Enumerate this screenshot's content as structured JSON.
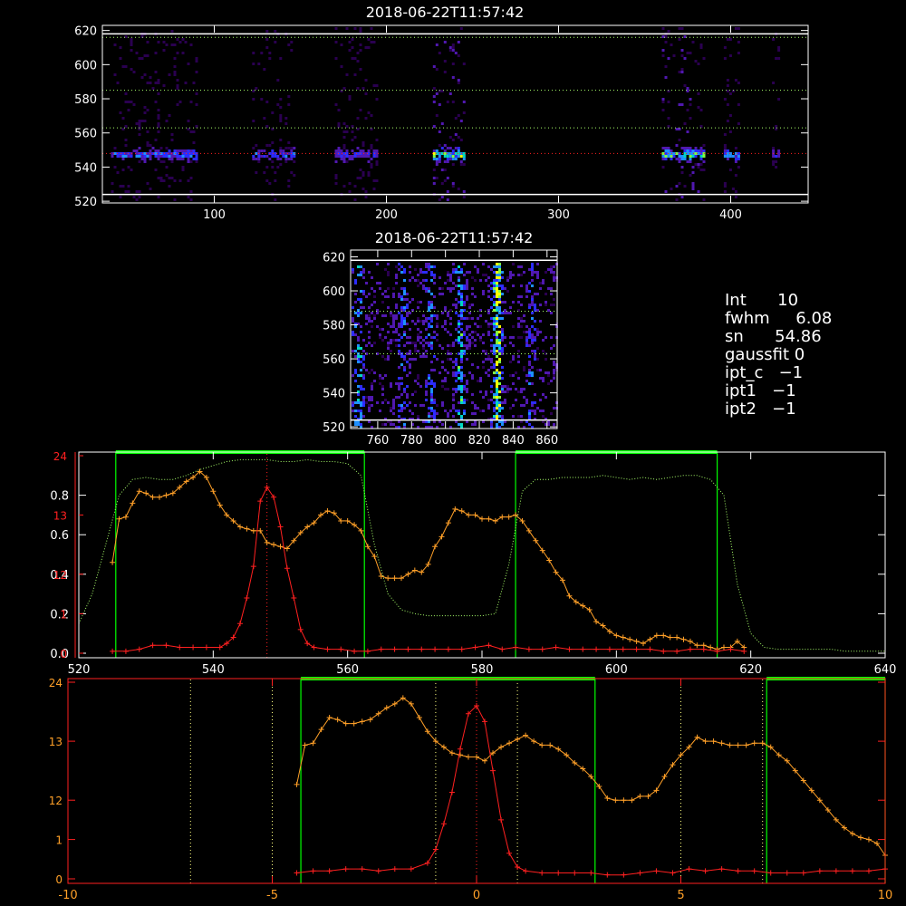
{
  "colors": {
    "background": "#000000",
    "axes": "#ffffff",
    "orange": "#ffa028",
    "red": "#ff2020",
    "green": "#00ff00",
    "green_dotted": "#a8ff6a",
    "yellow_dotted": "#ffff80"
  },
  "info": {
    "int_label": "Int",
    "int_value": "10",
    "fwhm_label": "fwhm",
    "fwhm_value": "6.08",
    "sn_label": "sn",
    "sn_value": "54.86",
    "gaussfit_label": "gaussfit",
    "gaussfit_value": "0",
    "ipt_c_label": "ipt_c",
    "ipt_c_value": "−1",
    "ipt1_label": "ipt1",
    "ipt1_value": "−1",
    "ipt2_label": "ipt2",
    "ipt2_value": "−1"
  },
  "chart_data": [
    {
      "type": "heatmap",
      "title": "2018-06-22T11:57:42",
      "xlim": [
        35,
        445
      ],
      "ylim": [
        519,
        623
      ],
      "x_ticks": [
        100,
        200,
        300,
        400
      ],
      "y_ticks": [
        520,
        540,
        560,
        580,
        600,
        620
      ],
      "bands": [
        {
          "x": [
            40,
            90
          ],
          "intensity": 0.55
        },
        {
          "x": [
            122,
            147
          ],
          "intensity": 0.5
        },
        {
          "x": [
            170,
            195
          ],
          "intensity": 0.45
        },
        {
          "x": [
            227,
            245
          ],
          "intensity": 0.85
        },
        {
          "x": [
            360,
            385
          ],
          "intensity": 0.8
        },
        {
          "x": [
            396,
            405
          ],
          "intensity": 0.6
        },
        {
          "x": [
            424,
            428
          ],
          "intensity": 0.4
        }
      ],
      "hlines_dotted_green": [
        616,
        585,
        563
      ],
      "hline_dotted_red": 548,
      "hlines_solid_white": [
        618,
        524
      ]
    },
    {
      "type": "heatmap",
      "title": "2018-06-22T11:57:42",
      "xlim": [
        744,
        866
      ],
      "ylim": [
        519,
        624
      ],
      "x_ticks": [
        760,
        780,
        800,
        820,
        840,
        860
      ],
      "y_ticks": [
        520,
        540,
        560,
        580,
        600,
        620
      ],
      "columns": [
        {
          "x": 748,
          "intensity": 0.5
        },
        {
          "x": 774,
          "intensity": 0.35
        },
        {
          "x": 790,
          "intensity": 0.4
        },
        {
          "x": 808,
          "intensity": 0.55
        },
        {
          "x": 830,
          "intensity": 0.85
        },
        {
          "x": 850,
          "intensity": 0.3
        }
      ],
      "hlines_dotted": [
        588,
        563
      ],
      "hlines_solid_white": [
        618,
        524
      ]
    },
    {
      "type": "line",
      "xlim": [
        520,
        640
      ],
      "ylim_left_white": [
        0.0,
        1.0
      ],
      "ylim_left_red": [
        0,
        24
      ],
      "x_ticks": [
        520,
        540,
        560,
        580,
        600,
        620,
        640
      ],
      "y_ticks_white": [
        0.0,
        0.2,
        0.4,
        0.6,
        0.8
      ],
      "y_ticks_red": [
        0,
        1,
        12,
        13,
        24
      ],
      "series": [
        {
          "color": "orange",
          "x": [
            525,
            526,
            527,
            528,
            529,
            530,
            531,
            532,
            533,
            534,
            535,
            536,
            537,
            538,
            539,
            540,
            541,
            542,
            543,
            544,
            545,
            546,
            547,
            548,
            549,
            550,
            551,
            552,
            553,
            554,
            555,
            556,
            557,
            558,
            559,
            560,
            561,
            562,
            563,
            564,
            565,
            566,
            567,
            568,
            569,
            570,
            571,
            572,
            573,
            574,
            575,
            576,
            577,
            578,
            579,
            580,
            581,
            582,
            583,
            584,
            585,
            586,
            587,
            588,
            589,
            590,
            591,
            592,
            593,
            594,
            595,
            596,
            597,
            598,
            599,
            600,
            601,
            602,
            603,
            604,
            605,
            606,
            607,
            608,
            609,
            610,
            611,
            612,
            613,
            614,
            615,
            616,
            617,
            618,
            619
          ],
          "values": [
            0.46,
            0.68,
            0.69,
            0.76,
            0.82,
            0.81,
            0.79,
            0.79,
            0.8,
            0.81,
            0.84,
            0.87,
            0.89,
            0.92,
            0.89,
            0.82,
            0.75,
            0.7,
            0.67,
            0.64,
            0.63,
            0.62,
            0.62,
            0.56,
            0.55,
            0.54,
            0.53,
            0.57,
            0.61,
            0.64,
            0.66,
            0.7,
            0.72,
            0.71,
            0.67,
            0.67,
            0.65,
            0.62,
            0.54,
            0.49,
            0.39,
            0.38,
            0.38,
            0.38,
            0.4,
            0.42,
            0.41,
            0.45,
            0.54,
            0.59,
            0.66,
            0.73,
            0.72,
            0.7,
            0.7,
            0.68,
            0.68,
            0.67,
            0.69,
            0.69,
            0.7,
            0.67,
            0.62,
            0.57,
            0.52,
            0.47,
            0.41,
            0.37,
            0.29,
            0.26,
            0.24,
            0.22,
            0.16,
            0.14,
            0.11,
            0.09,
            0.08,
            0.07,
            0.06,
            0.05,
            0.07,
            0.09,
            0.09,
            0.08,
            0.08,
            0.07,
            0.06,
            0.04,
            0.04,
            0.03,
            0.02,
            0.03,
            0.03,
            0.06,
            0.03
          ]
        },
        {
          "color": "red",
          "x": [
            525,
            527,
            529,
            531,
            533,
            535,
            537,
            539,
            541,
            542,
            543,
            544,
            545,
            546,
            547,
            548,
            549,
            550,
            551,
            552,
            553,
            554,
            555,
            557,
            559,
            561,
            563,
            565,
            567,
            569,
            571,
            573,
            575,
            577,
            579,
            581,
            583,
            585,
            587,
            589,
            591,
            593,
            595,
            597,
            599,
            601,
            603,
            605,
            607,
            609,
            611,
            613,
            615,
            617,
            619
          ],
          "values": [
            0.01,
            0.01,
            0.02,
            0.04,
            0.04,
            0.03,
            0.03,
            0.03,
            0.03,
            0.05,
            0.08,
            0.15,
            0.28,
            0.44,
            0.77,
            0.84,
            0.79,
            0.64,
            0.43,
            0.28,
            0.12,
            0.05,
            0.03,
            0.02,
            0.02,
            0.01,
            0.01,
            0.02,
            0.02,
            0.02,
            0.02,
            0.02,
            0.02,
            0.02,
            0.03,
            0.04,
            0.02,
            0.03,
            0.02,
            0.02,
            0.03,
            0.02,
            0.02,
            0.02,
            0.02,
            0.02,
            0.02,
            0.02,
            0.01,
            0.01,
            0.02,
            0.02,
            0.01,
            0.02,
            0.01
          ]
        },
        {
          "color": "green_dotted",
          "x": [
            520,
            522,
            524,
            526,
            528,
            530,
            532,
            534,
            536,
            538,
            540,
            542,
            544,
            546,
            548,
            550,
            552,
            554,
            556,
            558,
            560,
            562,
            564,
            566,
            568,
            570,
            572,
            574,
            576,
            578,
            580,
            582,
            584,
            586,
            588,
            590,
            592,
            594,
            596,
            598,
            600,
            602,
            604,
            606,
            608,
            610,
            612,
            614,
            616,
            618,
            620,
            622,
            624,
            626,
            628,
            630,
            632,
            634,
            636,
            638,
            640
          ],
          "values": [
            0.15,
            0.3,
            0.55,
            0.8,
            0.88,
            0.89,
            0.88,
            0.88,
            0.9,
            0.93,
            0.95,
            0.97,
            0.98,
            0.98,
            0.98,
            0.97,
            0.97,
            0.98,
            0.97,
            0.97,
            0.96,
            0.9,
            0.55,
            0.3,
            0.22,
            0.2,
            0.19,
            0.19,
            0.19,
            0.19,
            0.19,
            0.2,
            0.45,
            0.82,
            0.88,
            0.88,
            0.89,
            0.89,
            0.89,
            0.9,
            0.89,
            0.88,
            0.89,
            0.88,
            0.89,
            0.9,
            0.9,
            0.88,
            0.8,
            0.35,
            0.1,
            0.03,
            0.02,
            0.02,
            0.02,
            0.02,
            0.02,
            0.01,
            0.01,
            0.01,
            0.01
          ]
        }
      ],
      "green_windows": [
        [
          525.5,
          562.5
        ],
        [
          585,
          615
        ]
      ],
      "red_center_line": 548
    },
    {
      "type": "line",
      "xlim": [
        -10,
        10
      ],
      "ylim_left_red": [
        0,
        24
      ],
      "x_ticks": [
        -10,
        -5,
        0,
        5,
        10
      ],
      "y_ticks_red": [
        0,
        1,
        12,
        13,
        24
      ],
      "series": [
        {
          "color": "orange",
          "x": [
            -4.4,
            -4.2,
            -4.0,
            -3.8,
            -3.6,
            -3.4,
            -3.2,
            -3.0,
            -2.8,
            -2.6,
            -2.4,
            -2.2,
            -2.0,
            -1.8,
            -1.6,
            -1.4,
            -1.2,
            -1.0,
            -0.8,
            -0.6,
            -0.4,
            -0.2,
            0.0,
            0.2,
            0.4,
            0.6,
            0.8,
            1.0,
            1.2,
            1.4,
            1.6,
            1.8,
            2.0,
            2.2,
            2.4,
            2.6,
            2.8,
            3.0,
            3.2,
            3.4,
            3.6,
            3.8,
            4.0,
            4.2,
            4.4,
            4.6,
            4.8,
            5.0,
            5.2,
            5.4,
            5.6,
            5.8,
            6.0,
            6.2,
            6.4,
            6.6,
            6.8,
            7.0,
            7.2,
            7.4,
            7.6,
            7.8,
            8.0,
            8.2,
            8.4,
            8.6,
            8.8,
            9.0,
            9.2,
            9.4,
            9.6,
            9.8,
            10.0
          ],
          "values": [
            0.48,
            0.68,
            0.69,
            0.76,
            0.82,
            0.81,
            0.79,
            0.79,
            0.8,
            0.81,
            0.84,
            0.87,
            0.89,
            0.92,
            0.89,
            0.82,
            0.75,
            0.7,
            0.67,
            0.64,
            0.63,
            0.62,
            0.62,
            0.6,
            0.64,
            0.67,
            0.69,
            0.71,
            0.73,
            0.7,
            0.68,
            0.68,
            0.66,
            0.63,
            0.59,
            0.56,
            0.52,
            0.47,
            0.41,
            0.4,
            0.4,
            0.4,
            0.42,
            0.42,
            0.45,
            0.52,
            0.58,
            0.63,
            0.67,
            0.72,
            0.7,
            0.7,
            0.69,
            0.68,
            0.68,
            0.68,
            0.69,
            0.69,
            0.67,
            0.63,
            0.6,
            0.55,
            0.5,
            0.45,
            0.4,
            0.35,
            0.3,
            0.26,
            0.23,
            0.21,
            0.2,
            0.18,
            0.12
          ]
        },
        {
          "color": "red",
          "x": [
            -4.4,
            -4.0,
            -3.6,
            -3.2,
            -2.8,
            -2.4,
            -2.0,
            -1.6,
            -1.2,
            -1.0,
            -0.8,
            -0.6,
            -0.4,
            -0.2,
            0.0,
            0.2,
            0.4,
            0.6,
            0.8,
            1.0,
            1.2,
            1.6,
            2.0,
            2.4,
            2.8,
            3.2,
            3.6,
            4.0,
            4.4,
            4.8,
            5.2,
            5.6,
            6.0,
            6.4,
            6.8,
            7.2,
            7.6,
            8.0,
            8.4,
            8.8,
            9.2,
            9.6,
            10.0
          ],
          "values": [
            0.03,
            0.04,
            0.04,
            0.05,
            0.05,
            0.04,
            0.05,
            0.05,
            0.08,
            0.15,
            0.28,
            0.44,
            0.66,
            0.84,
            0.88,
            0.8,
            0.55,
            0.3,
            0.13,
            0.06,
            0.04,
            0.03,
            0.03,
            0.03,
            0.03,
            0.02,
            0.02,
            0.03,
            0.04,
            0.03,
            0.05,
            0.04,
            0.05,
            0.04,
            0.04,
            0.03,
            0.03,
            0.03,
            0.04,
            0.04,
            0.04,
            0.04,
            0.05
          ]
        }
      ],
      "green_windows": [
        [
          -4.3,
          2.9
        ],
        [
          7.1,
          10.0
        ]
      ],
      "yellow_dotted_lines": [
        -7.0,
        -5.0,
        -1.0,
        1.0,
        5.0,
        7.0
      ],
      "red_center_line": 0
    }
  ]
}
